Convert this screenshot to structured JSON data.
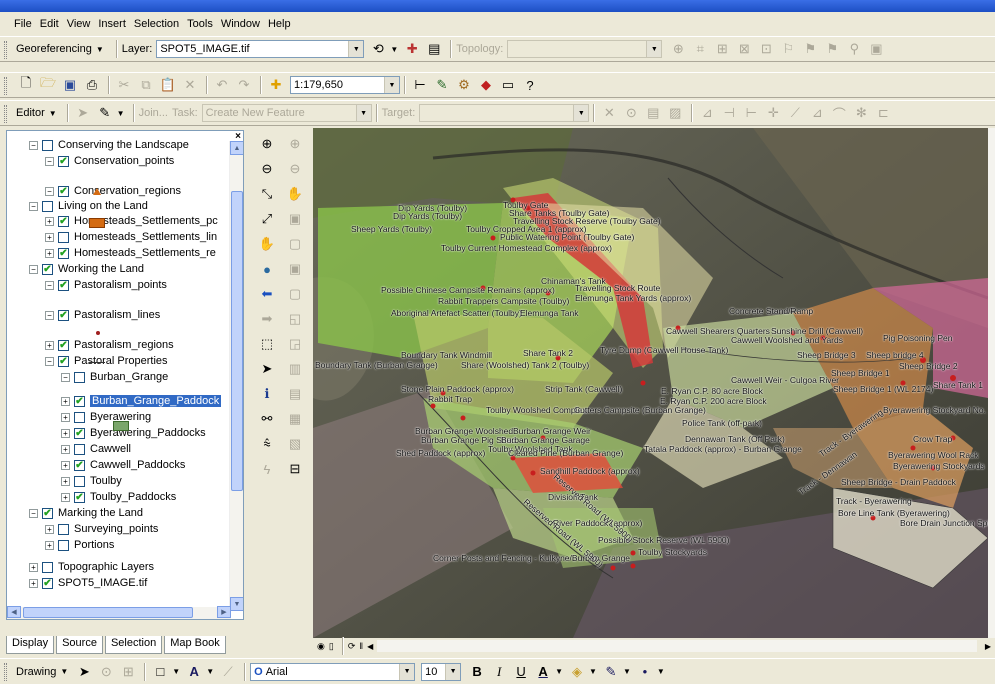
{
  "menu": [
    "File",
    "Edit",
    "View",
    "Insert",
    "Selection",
    "Tools",
    "Window",
    "Help"
  ],
  "georef_bar": {
    "georef_label": "Georeferencing",
    "layer_label": "Layer:",
    "layer_value": "SPOT5_IMAGE.tif",
    "topology_label": "Topology:"
  },
  "standard_bar": {
    "scale": "1:179,650"
  },
  "editor_bar": {
    "editor_label": "Editor",
    "join_label": "Join...",
    "task_label": "Task:",
    "task_value": "Create New Feature",
    "target_label": "Target:"
  },
  "toc": {
    "items": [
      {
        "label": "Conserving the Landscape",
        "checked": false,
        "expanded": true,
        "level": 0
      },
      {
        "label": "Conservation_points",
        "checked": true,
        "expanded": true,
        "level": 1
      },
      {
        "label": "Conservation_regions",
        "checked": true,
        "expanded": true,
        "level": 1
      },
      {
        "label": "Living on the Land",
        "checked": false,
        "expanded": true,
        "level": 0
      },
      {
        "label": "Homesteads_Settlements_pc",
        "checked": true,
        "expanded": false,
        "level": 1
      },
      {
        "label": "Homesteads_Settlements_lin",
        "checked": false,
        "expanded": false,
        "level": 1
      },
      {
        "label": "Homesteads_Settlements_re",
        "checked": true,
        "expanded": false,
        "level": 1
      },
      {
        "label": "Working the Land",
        "checked": true,
        "expanded": true,
        "level": 0
      },
      {
        "label": "Pastoralism_points",
        "checked": true,
        "expanded": true,
        "level": 1
      },
      {
        "label": "Pastoralism_lines",
        "checked": true,
        "expanded": true,
        "level": 1
      },
      {
        "label": "Pastoralism_regions",
        "checked": true,
        "expanded": false,
        "level": 1
      },
      {
        "label": "Pastoral Properties",
        "checked": true,
        "expanded": true,
        "level": 1
      },
      {
        "label": "Burban_Grange",
        "checked": false,
        "expanded": true,
        "level": 2
      },
      {
        "label": "Burban_Grange_Paddock",
        "checked": true,
        "expanded": false,
        "level": 2,
        "selected": true
      },
      {
        "label": "Byerawering",
        "checked": false,
        "expanded": false,
        "level": 2
      },
      {
        "label": "Byerawering_Paddocks",
        "checked": true,
        "expanded": false,
        "level": 2
      },
      {
        "label": "Cawwell",
        "checked": false,
        "expanded": false,
        "level": 2
      },
      {
        "label": "Cawwell_Paddocks",
        "checked": true,
        "expanded": false,
        "level": 2
      },
      {
        "label": "Toulby",
        "checked": false,
        "expanded": false,
        "level": 2
      },
      {
        "label": "Toulby_Paddocks",
        "checked": true,
        "expanded": false,
        "level": 2
      },
      {
        "label": "Marking the Land",
        "checked": true,
        "expanded": true,
        "level": 0
      },
      {
        "label": "Surveying_points",
        "checked": false,
        "expanded": false,
        "level": 1
      },
      {
        "label": "Portions",
        "checked": false,
        "expanded": false,
        "level": 1
      },
      {
        "label": "Topographic Layers",
        "checked": false,
        "expanded": false,
        "level": 0
      },
      {
        "label": "SPOT5_IMAGE.tif",
        "checked": true,
        "expanded": false,
        "level": 0
      }
    ]
  },
  "toc_tabs": [
    "Display",
    "Source",
    "Selection",
    "Map Book"
  ],
  "map_labels": [
    "Toulby Gate",
    "Dip Yards (Toulby)",
    "Share Tanks (Toulby Gate)",
    "Dip Yards (Toulby)",
    "Travelling Stock Reserve (Toulby Gate)",
    "Sheep Yards (Toulby)",
    "Toulby Cropped Area 1 (approx)",
    "Public Watering Point (Toulby Gate)",
    "Toulby Current Homestead Complex (approx)",
    "Chinaman's Tank",
    "Possible Chinese Campsite Remains (approx)",
    "Travelling Stock Route",
    "Rabbit Trappers Campsite (Toulby)",
    "Elemunga Tank Yards (approx)",
    "Aboriginal Artefact Scatter (Toulby)",
    "Elemunga Tank",
    "Concrete Stand/Ramp",
    "Cawwell Shearers Quarters",
    "Sunshine Drill (Cawwell)",
    "Cawwell Woolshed and Yards",
    "Pig Poisoning Pen",
    "Tyre Dump (Cawwell House Tank)",
    "Boundary Tank Windmill",
    "Share Tank 2",
    "Boundary Tank (Burban Grange)",
    "Share (Woolshed) Tank 2 (Toulby)",
    "Sheep Bridge 3",
    "Sheep bridge 4",
    "Sheep Bridge 2",
    "Sheep Bridge 1",
    "Stone Plain Paddock (approx)",
    "Strip Tank (Cawwell)",
    "Cawwell Weir - Culgoa River",
    "Sheep Bridge 1 (WL 2174)",
    "Share Tank 1",
    "Rabbit Trap",
    "E. Ryan C.P. 80 acre Block",
    "E. Ryan C.P. 200 acre Block",
    "Toulby Woolshed Complex",
    "Cutters Campsite (Burban Grange)",
    "Byerawering Stockyard No. 1",
    "Burban Grange Woolshed",
    "Burban Grange Weir",
    "Police Tank (off-park)",
    "Burban Grange Pig Shed",
    "Burban Grange Garage",
    "Toulby Woolshed Tank",
    "Dennawan Tank (Off Park)",
    "Shed Paddock (approx)",
    "Cleared Pine (Burban Grange)",
    "Tatala Paddock (approx) - Burban Grange",
    "Crow Trap",
    "Byerawering Wool Rack",
    "Byerawering Stockyards",
    "Sandhill Paddock (approx)",
    "Division Tank",
    "Sheep Bridge - Drain Paddock",
    "Track - Byerawering",
    "Bore Line Tank (Byerawering)",
    "Bore Drain Junction Spillway",
    "River Paddock (approx)",
    "Possible Stock Reserve (WL 5900)",
    "Toulby Stockyards",
    "Corner Posts and Fencing - Kulkyne/Burban Grange",
    "Reserved Road (WL 5900)",
    "Reserved Road (WL 5900)",
    "Track - Dennawan",
    "Track - Byerawering"
  ],
  "drawing_bar": {
    "drawing_label": "Drawing",
    "font": "Arial",
    "size": "10"
  },
  "colors": {
    "selection": "#316ac5",
    "conservation_region": "#d46b12",
    "burban_paddock": "#7aa66a"
  }
}
